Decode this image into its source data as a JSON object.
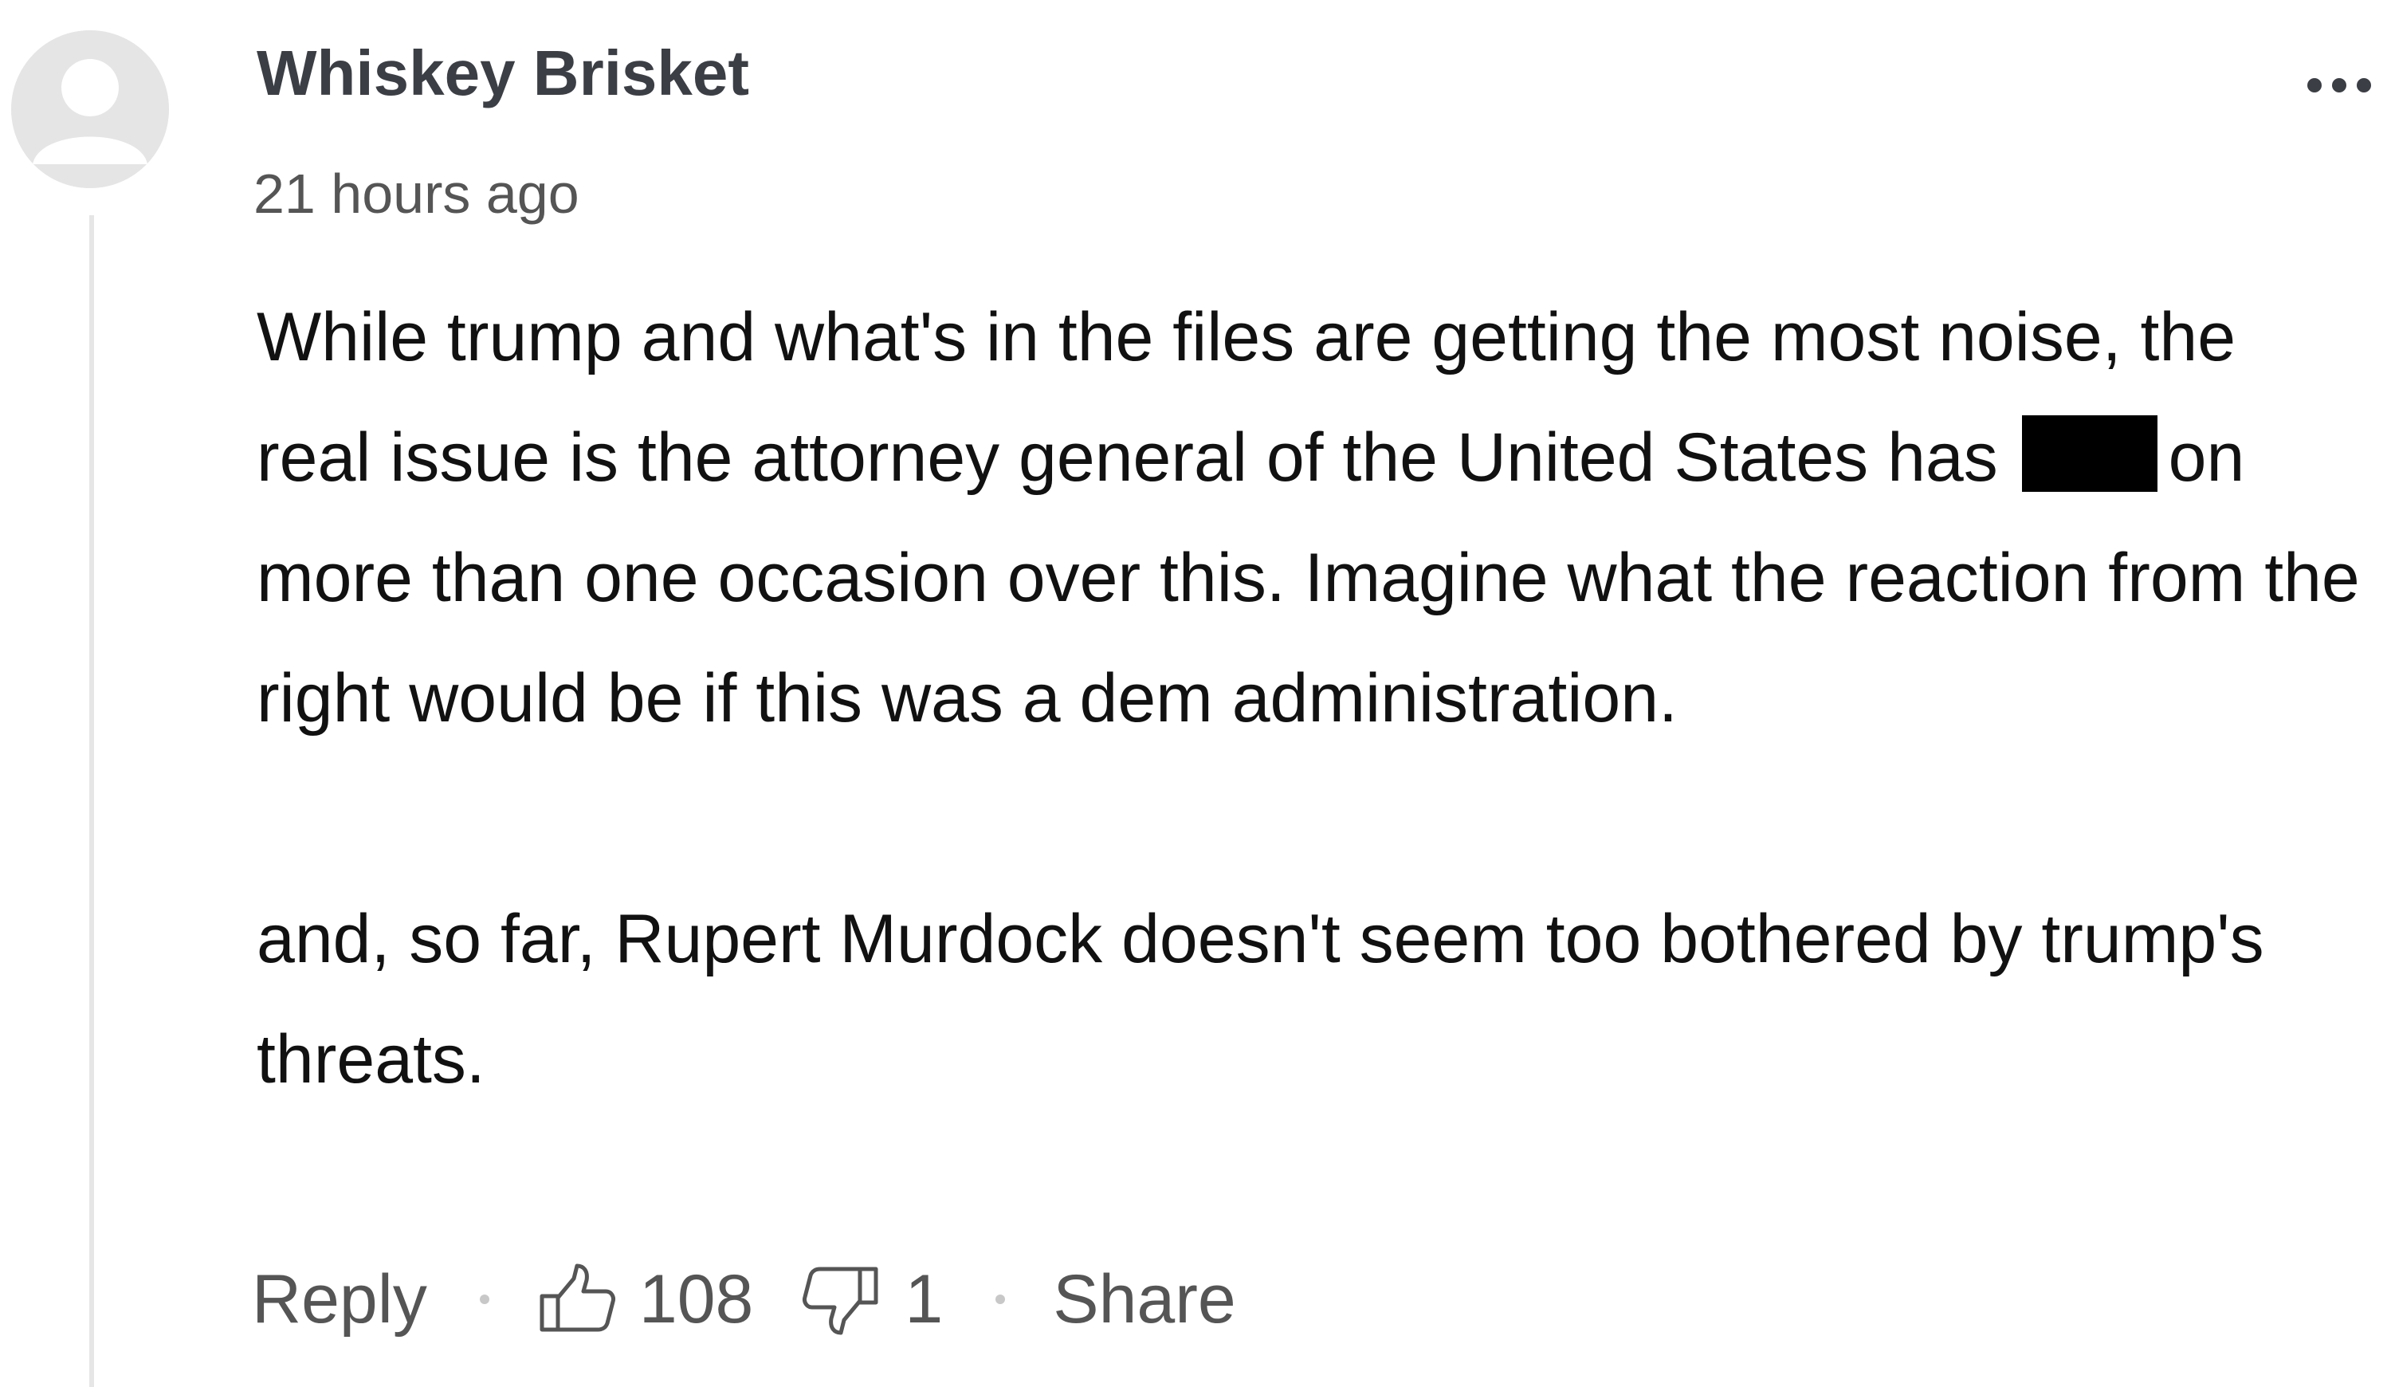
{
  "comment": {
    "author": "Whiskey Brisket",
    "timestamp": "21 hours ago",
    "avatar_icon": "user-avatar-icon",
    "menu_icon": "more-options-icon",
    "paragraphs": [
      {
        "before_redaction": "While trump and what's in the files are getting the most noise, the real issue is the attorney general of the United States has",
        "after_redaction": "on more than one occasion over this. Imagine what the reaction from the right would be if this was a dem administration."
      },
      {
        "text": "and, so far, Rupert Murdock doesn't seem too bothered by trump's threats."
      }
    ],
    "actions": {
      "reply_label": "Reply",
      "upvote_count": "108",
      "downvote_count": "1",
      "share_label": "Share",
      "upvote_icon": "thumbs-up-icon",
      "downvote_icon": "thumbs-down-icon"
    }
  },
  "colors": {
    "author": "#3b3f45",
    "body_text": "#111111",
    "meta_text": "#555555",
    "avatar_bg": "#e5e5e5",
    "thread_line": "#e6e6e6",
    "redaction": "#000000"
  }
}
